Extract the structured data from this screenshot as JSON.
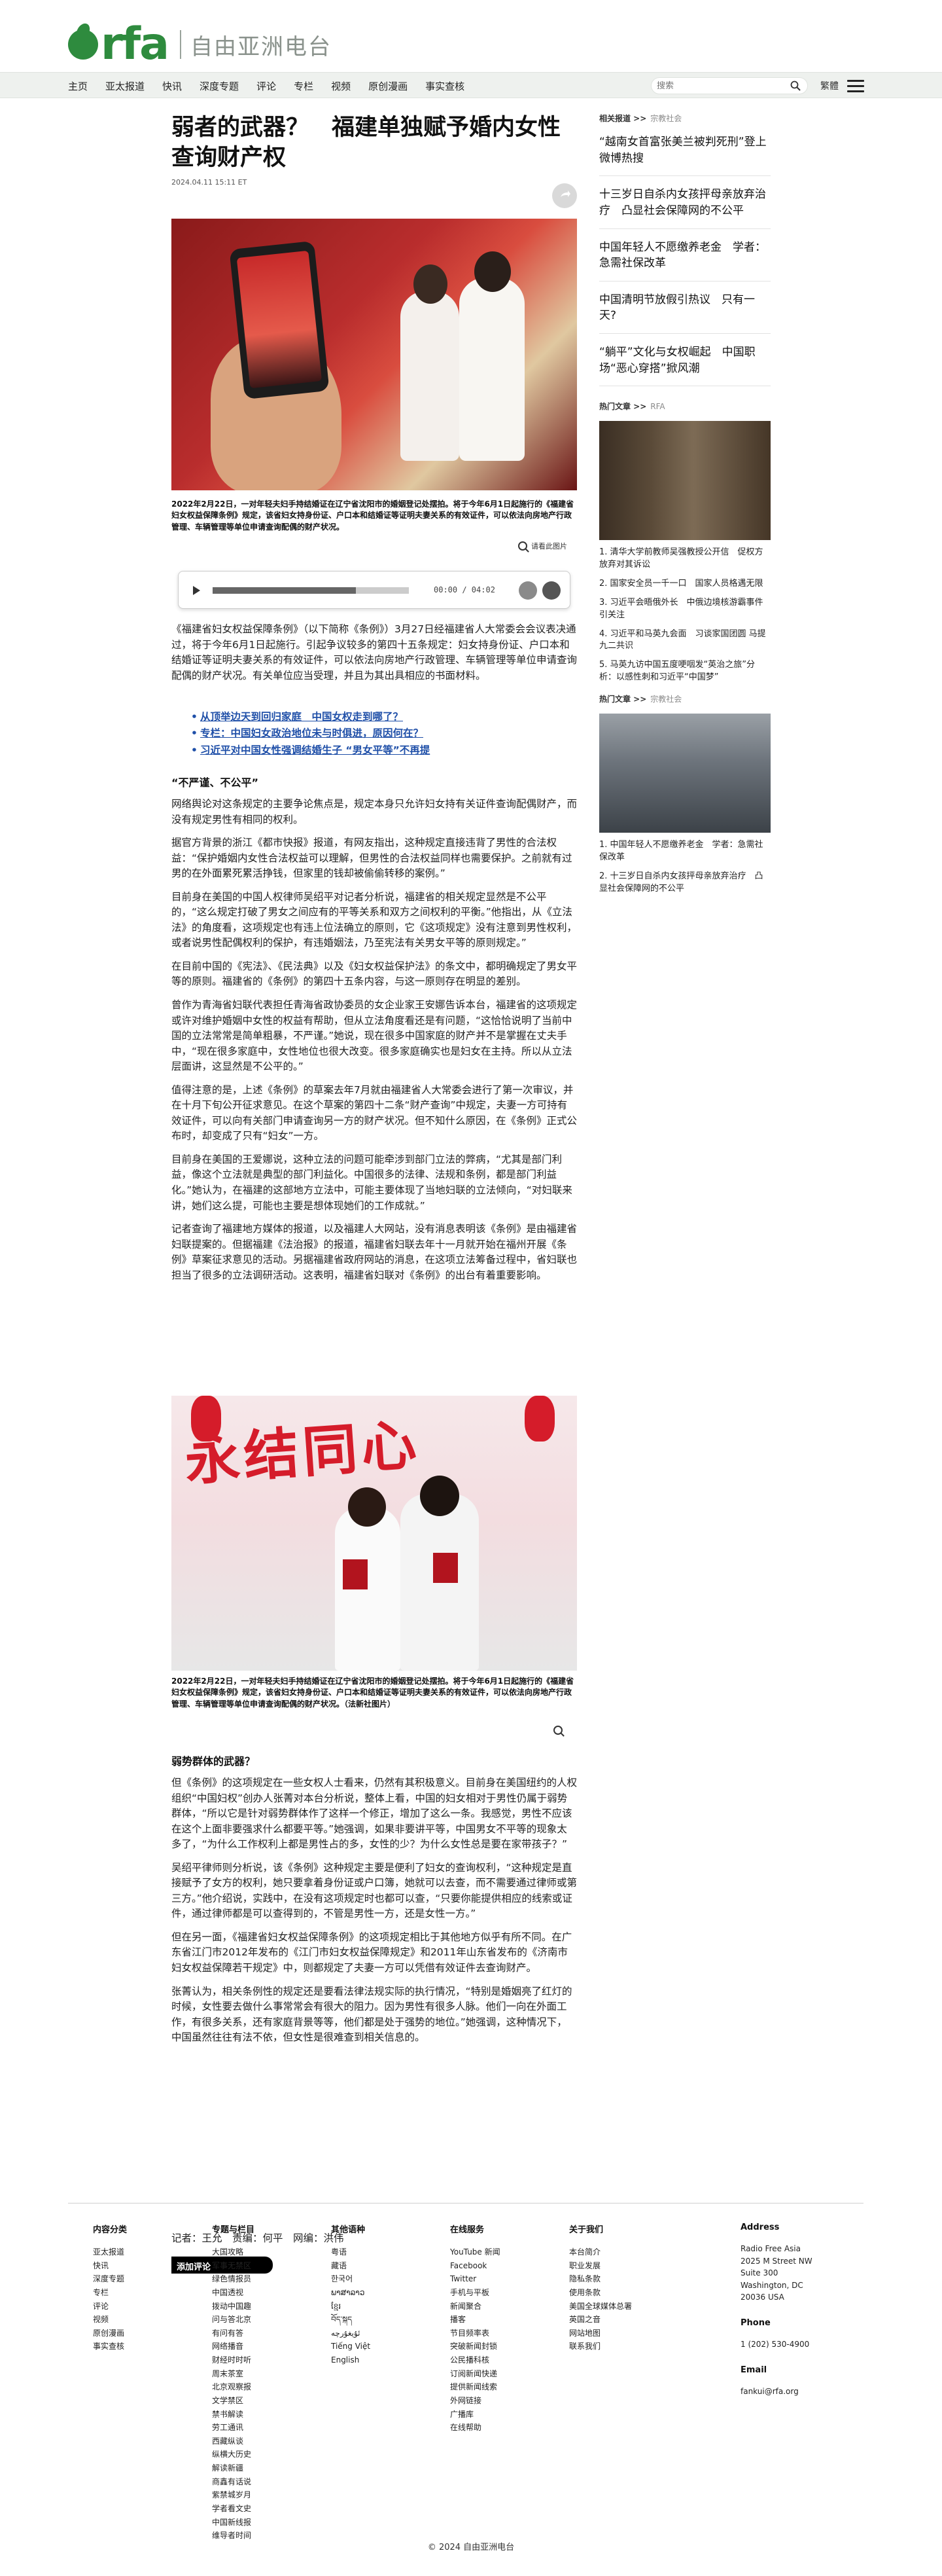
{
  "header": {
    "logo_text": "rfa",
    "logo_sub": "自由亚洲电台"
  },
  "nav": {
    "items": [
      "主页",
      "亚太报道",
      "快讯",
      "深度专题",
      "评论",
      "专栏",
      "视频",
      "原创漫画",
      "事实查核"
    ],
    "search_placeholder": "搜索",
    "lang_toggle": "繁體"
  },
  "article": {
    "headline": "弱者的武器？　福建单独赋予婚内女性查询财产权",
    "date": "2024.04.11 15:11 ET",
    "photo1_caption": "2022年2月22日，一对年轻夫妇手持结婚证在辽宁省沈阳市的婚姻登记处摆拍。将于今年6月1日起施行的《福建省妇女权益保障条例》规定，该省妇女持身份证、户口本和结婚证等证明夫妻关系的有效证件，可以依法向房地产行政管理、车辆管理等单位申请查询配偶的财产状况。",
    "enlarge_label": "请看此图片",
    "audio": {
      "time": "00:00 / 04:02",
      "progress_percent": 73
    },
    "intro": "《福建省妇女权益保障条例》（以下简称《条例》）3月27日经福建省人大常委会会议表决通过，将于今年6月1日起施行。引起争议较多的第四十五条规定：妇女持身份证、户口本和结婚证等证明夫妻关系的有效证件，可以依法向房地产行政管理、车辆管理等单位申请查询配偶的财产状况。有关单位应当受理，并且为其出具相应的书面材料。",
    "related": [
      "从顶举边天到回归家庭　中国女权走到哪了？",
      "专栏：中国妇女政治地位未与时俱进，原因何在？",
      "习近平对中国女性强调结婚生子 “男女平等”不再提"
    ],
    "subhead1": "“不严谨、不公平”",
    "paragraphs1": [
      "网络舆论对这条规定的主要争论焦点是，规定本身只允许妇女持有关证件查询配偶财产，而没有规定男性有相同的权利。",
      "据官方背景的浙江《都市快报》报道，有网友指出，这种规定直接违背了男性的合法权益：“保护婚姻内女性合法权益可以理解，但男性的合法权益同样也需要保护。之前就有过男的在外面累死累活挣钱，但家里的钱却被偷偷转移的案例。”",
      "目前身在美国的中国人权律师吴绍平对记者分析说，福建省的相关规定显然是不公平的，“这么规定打破了男女之间应有的平等关系和双方之间权利的平衡。”他指出，从《立法法》的角度看，这项规定也有违上位法确立的原则，它《这项规定》没有注意到男性权利，或者说男性配偶权利的保护，有违婚姻法，乃至宪法有关男女平等的原则规定。”",
      "在目前中国的《宪法》、《民法典》以及《妇女权益保护法》的条文中，都明确规定了男女平等的原则。福建省的《条例》的第四十五条内容，与这一原则存在明显的差别。",
      "曾作为青海省妇联代表担任青海省政协委员的女企业家王安娜告诉本台，福建省的这项规定或许对维护婚姻中女性的权益有帮助，但从立法角度看还是有问题，“这恰恰说明了当前中国的立法常常是简单粗暴，不严谨。”她说，现在很多中国家庭的财产并不是掌握在丈夫手中，“现在很多家庭中，女性地位也很大改变。很多家庭确实也是妇女在主持。所以从立法层面讲，这显然是不公平的。”",
      "值得注意的是，上述《条例》的草案去年7月就由福建省人大常委会进行了第一次审议，并在十月下旬公开征求意见。在这个草案的第四十二条“财产查询”中规定，夫妻一方可持有效证件，可以向有关部门申请查询另一方的财产状况。但不知什么原因，在《条例》正式公布时，却变成了只有“妇女”一方。",
      "目前身在美国的王爱娜说，这种立法的问题可能牵涉到部门立法的弊病，“尤其是部门利益，像这个立法就是典型的部门利益化。中国很多的法律、法规和条例，都是部门利益化。”她认为，在福建的这部地方立法中，可能主要体现了当地妇联的立法倾向，“对妇联来讲，她们这么提，可能也主要是想体现她们的工作成就。”",
      "记者查询了福建地方媒体的报道，以及福建人大网站，没有消息表明该《条例》是由福建省妇联提案的。但据福建《法治报》的报道，福建省妇联去年十一月就开始在福州开展《条例》草案征求意见的活动。另据福建省政府网站的消息，在这项立法筹备过程中，省妇联也担当了很多的立法调研活动。这表明，福建省妇联对《条例》的出台有着重要影响。"
    ],
    "photo2_banner": "永结同心",
    "photo2_caption": "2022年2月22日，一对年轻夫妇手持结婚证在辽宁省沈阳市的婚姻登记处摆拍。将于今年6月1日起施行的《福建省妇女权益保障条例》规定，该省妇女持身份证、户口本和结婚证等证明夫妻关系的有效证件，可以依法向房地产行政管理、车辆管理等单位申请查询配偶的财产状况。（法新社图片）",
    "subhead2": "弱势群体的武器？",
    "paragraphs2": [
      "但《条例》的这项规定在一些女权人士看来，仍然有其积极意义。目前身在美国纽约的人权组织“中国妇权”创办人张菁对本台分析说，整体上看，中国的妇女相对于男性仍属于弱势群体，“所以它是针对弱势群体作了这样一个修正，增加了这么一条。我感觉，男性不应该在这个上面非要强求什么都要平等。”她强调，如果非要讲平等，中国男女不平等的现象太多了，“为什么工作权利上都是男性占的多，女性的少？为什么女性总是要在家带孩子？”",
      "吴绍平律师则分析说，该《条例》这种规定主要是便利了妇女的查询权利，“这种规定是直接赋予了女方的权利，她只要拿着身份证或户口簿，她就可以去查，而不需要通过律师或第三方。”他介绍说，实践中，在没有这项规定时也都可以查，“只要你能提供相应的线索或证件，通过律师都是可以查得到的，不管是男性一方，还是女性一方。”",
      "但在另一面，《福建省妇女权益保障条例》的这项规定相比于其他地方似乎有所不同。在广东省江门市2012年发布的《江门市妇女权益保障规定》和2011年山东省发布的《济南市妇女权益保障若干规定》中，则都规定了夫妻一方可以凭借有效证件去查询财产。",
      "张菁认为，相关条例性的规定还是要看法律法规实际的执行情况，“特别是婚姻亮了红灯的时候，女性要去做什么事常常会有很大的阻力。因为男性有很多人脉。他们一向在外面工作，有很多关系，还有家庭背景等等，他们都是处于强势的地位。”她强调，这种情况下，中国虽然往往有法不依，但女性是很难查到相关信息的。"
    ],
    "byline": "记者：王允　责编：何平　网编：洪伟",
    "comment_button": "添加评论"
  },
  "sidebar": {
    "related_label": "相关报道 >>",
    "related_category": "宗教社会",
    "related_stories": [
      "“越南女首富张美兰被判死刑”登上微博热搜",
      "十三岁日自杀内女孩抨母亲放弃治疗　凸显社会保障网的不公平",
      "中国年轻人不愿缴养老金　学者：急需社保改革",
      "中国清明节放假引热议　只有一天?",
      "“躺平”文化与女权崛起　中国职场“恶心穿搭”掀风潮"
    ],
    "hot_label": "热门文章 >>",
    "hot_category": "RFA",
    "hot_list": [
      "1. 清华大学前教师吴强教授公开信　促权方放弃对其诉讼",
      "2. 国家安全员一千一口　国家人员格遇无限",
      "3. 习近平会晤俄外长　中俄边境核游霸事件引关注",
      "4. 习近平和马英九会面　习谈家国团圆 马提九二共识",
      "5. 马英九访中国五度哽咽发“英治之旅”分析：以感性刺和习近平“中国梦”"
    ],
    "hot2_label": "热门文章 >>",
    "hot2_category": "宗教社会",
    "hot2_list": [
      "1. 中国年轻人不愿缴养老金　学者：急需社保改革",
      "2. 十三岁日自杀内女孩抨母亲放弃治疗　凸显社会保障网的不公平"
    ]
  },
  "footer": {
    "columns": [
      {
        "title": "内容分类",
        "items": [
          "亚太报道",
          "快讯",
          "深度专题",
          "专栏",
          "评论",
          "视频",
          "原创漫画",
          "事实查核"
        ]
      },
      {
        "title": "专题与栏目",
        "items": [
          "大国攻略",
          "军事无禁区",
          "绿色情报员",
          "中国透视",
          "拨动中国趣",
          "问与答北京",
          "有问有答",
          "网络播音",
          "财经时时听",
          "周末茶室",
          "北京观察报",
          "文学禁区",
          "禁书解读",
          "劳工通讯",
          "西藏纵谈",
          "纵横大历史",
          "解读新疆",
          "商鑫有话说",
          "紫禁城岁月",
          "学者看文史",
          "中国新线报",
          "维导者时间"
        ]
      },
      {
        "title": "其他语种",
        "items": [
          "粤语",
          "藏语",
          "한국어",
          "ພາສາລາວ",
          "ខ្មែរ",
          "བོད་སྐད",
          "ئۇيغۇرچە",
          "Tiếng Việt",
          "English"
        ]
      },
      {
        "title": "在线服务",
        "items": [
          "YouTube 新闻",
          "Facebook",
          "Twitter",
          "手机与平板",
          "新闻聚合",
          "播客",
          "节目频率表",
          "突破新闻封锁",
          "公民播科核",
          "订阅新闻快递",
          "提供新闻线索",
          "外网链接",
          "广播库",
          "在线帮助"
        ]
      },
      {
        "title": "关于我们",
        "items": [
          "本台简介",
          "职业发展",
          "隐私条款",
          "使用条款",
          "美国全球媒体总署",
          "英国之音",
          "网站地图",
          "联系我们"
        ]
      }
    ],
    "address_title": "Address",
    "address": [
      "Radio Free Asia",
      "2025 M Street NW",
      "Suite 300",
      "Washington, DC",
      "20036 USA"
    ],
    "phone_title": "Phone",
    "phone": "1 (202) 530-4900",
    "email_title": "Email",
    "email": "fankui@rfa.org",
    "copyright": "© 2024 自由亚洲电台"
  }
}
